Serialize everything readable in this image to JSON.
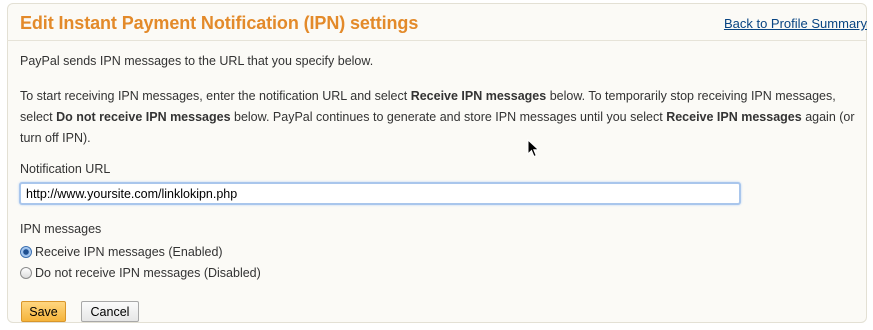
{
  "header": {
    "title": "Edit Instant Payment Notification (IPN) settings",
    "back_link": "Back to Profile Summary"
  },
  "intro": "PayPal sends IPN messages to the URL that you specify below.",
  "instructions": {
    "t1": "To start receiving IPN messages, enter the notification URL and select ",
    "b1": "Receive IPN messages",
    "t2": " below. To temporarily stop receiving IPN messages, select ",
    "b2": "Do not receive IPN messages",
    "t3": " below. PayPal continues to generate and store IPN messages until you select ",
    "b3": "Receive IPN messages",
    "t4": " again (or turn off IPN)."
  },
  "notification_url": {
    "label": "Notification URL",
    "value": "http://www.yoursite.com/linklokipn.php"
  },
  "ipn_messages": {
    "label": "IPN messages",
    "options": [
      {
        "label": "Receive IPN messages (Enabled)",
        "selected": true
      },
      {
        "label": "Do not receive IPN messages (Disabled)",
        "selected": false
      }
    ]
  },
  "buttons": {
    "save": "Save",
    "cancel": "Cancel"
  },
  "colors": {
    "title": "#e38a2a",
    "link": "#084482",
    "save_button": "#f5b43b"
  },
  "icons": {
    "cursor": "mouse-pointer-icon",
    "radio_on": "radio-selected-icon",
    "radio_off": "radio-unselected-icon"
  }
}
